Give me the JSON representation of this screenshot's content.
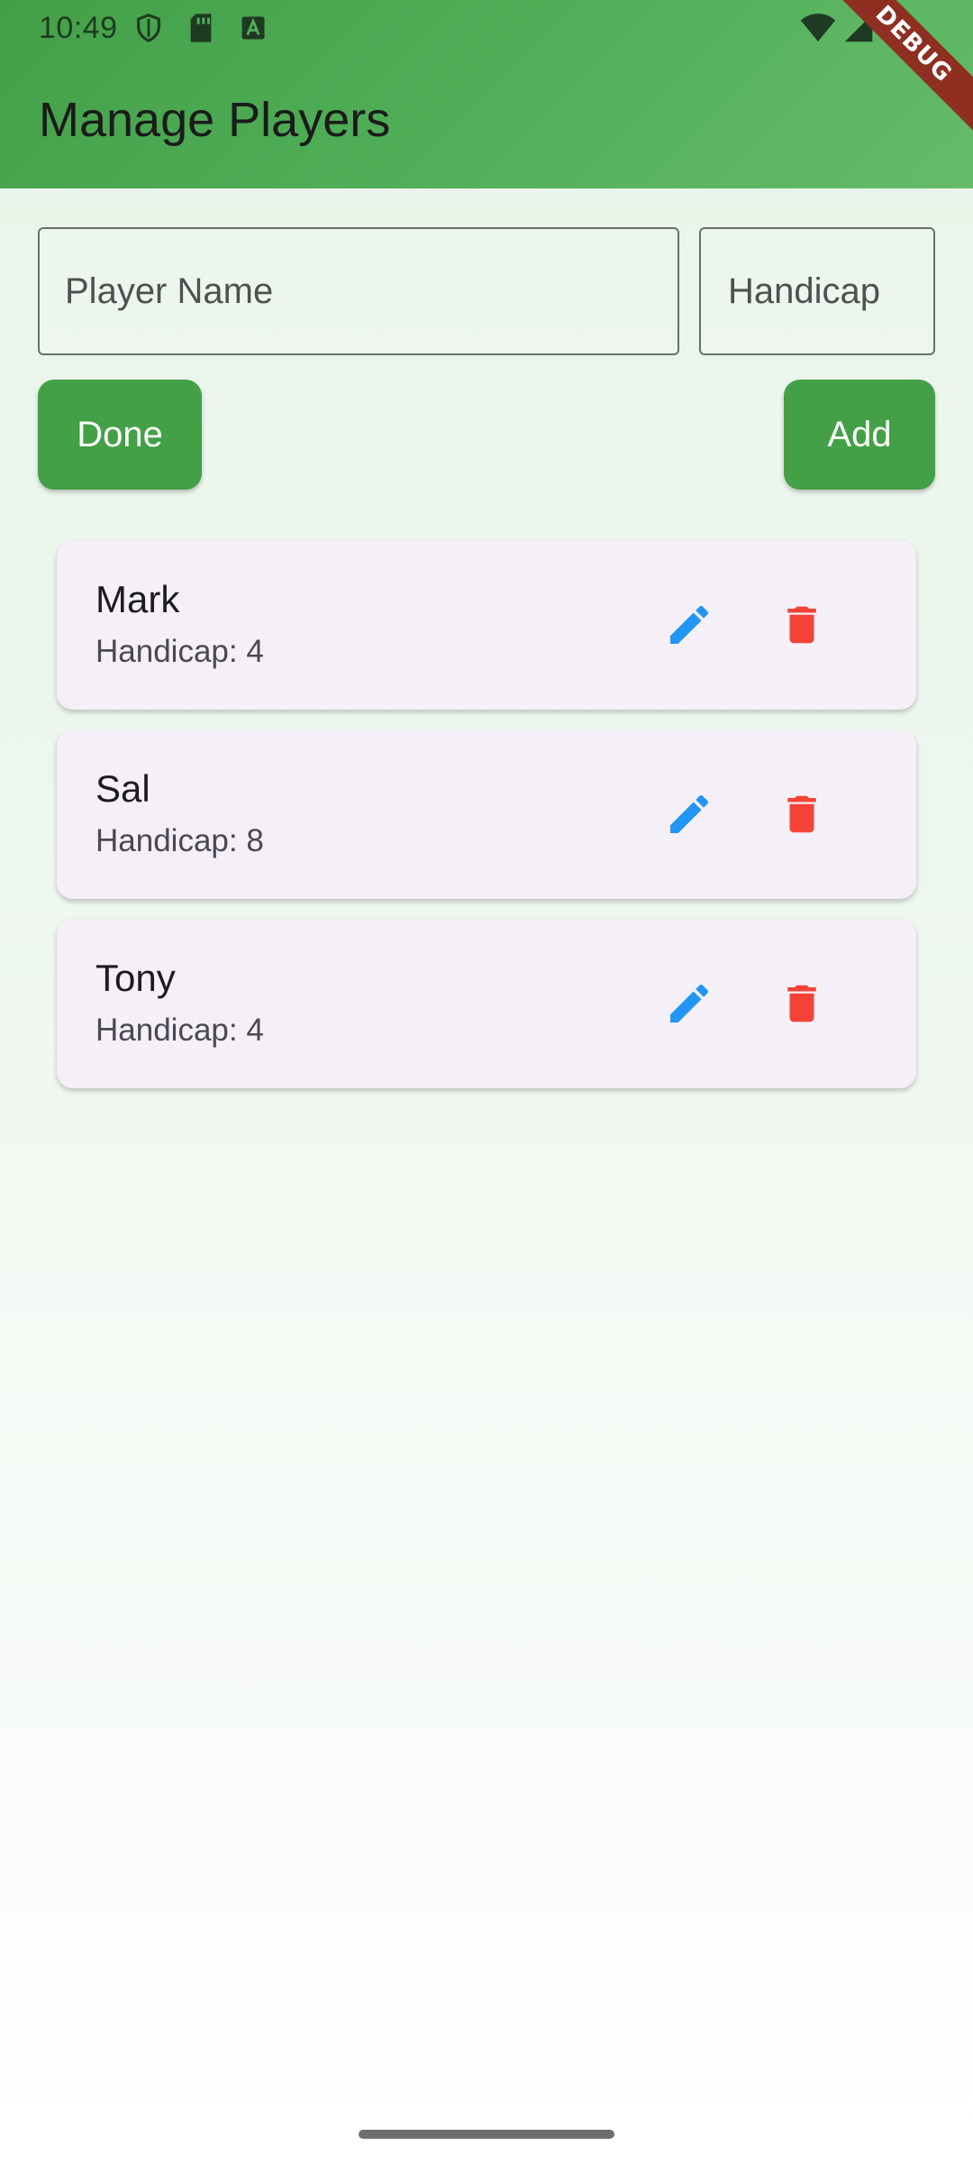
{
  "status_bar": {
    "time": "10:49",
    "left_icons": [
      "shield-icon",
      "sd-card-icon",
      "text-a-icon"
    ],
    "right_icons": [
      "wifi-icon",
      "cellular-signal-icon",
      "battery-icon"
    ]
  },
  "app_bar": {
    "title": "Manage Players",
    "debug_banner": "DEBUG"
  },
  "form": {
    "name_placeholder": "Player Name",
    "name_value": "",
    "handicap_placeholder": "Handicap",
    "handicap_value": "",
    "done_label": "Done",
    "add_label": "Add"
  },
  "players": [
    {
      "name": "Mark",
      "handicap": "Handicap: 4"
    },
    {
      "name": "Sal",
      "handicap": "Handicap: 8"
    },
    {
      "name": "Tony",
      "handicap": "Handicap: 4"
    }
  ],
  "colors": {
    "primary": "#43a047",
    "edit_icon": "#2196f3",
    "delete_icon": "#f44336",
    "card_background": "#f5f0f7",
    "debug_banner": "#8e2f22"
  }
}
